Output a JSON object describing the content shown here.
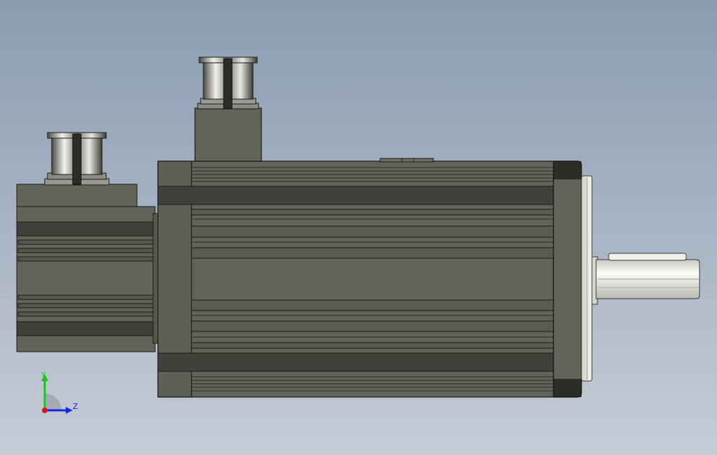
{
  "viewport": {
    "background_top": "#8a9cb0",
    "background_bottom": "#c6ccd7"
  },
  "model": {
    "body_color": "#626458",
    "band_color": "#3f413a",
    "edge_color": "#1a1a1a",
    "flange_color": "#2c2d28",
    "shaft_color": "#e4e4e0"
  },
  "triad": {
    "y_label": "Y",
    "z_label": "Z",
    "y_color": "#18c818",
    "z_color": "#1428e0",
    "x_color": "#e01414"
  }
}
